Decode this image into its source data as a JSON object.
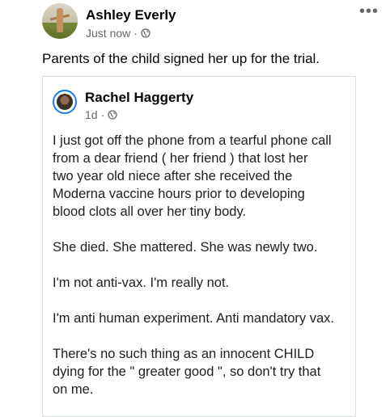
{
  "post": {
    "author": "Ashley Everly",
    "timestamp": "Just now",
    "separator": "·",
    "privacy_icon": "globe-icon",
    "more_label": "•••",
    "text": "Parents of the child signed her up for the trial."
  },
  "shared_post": {
    "author": "Rachel Haggerty",
    "timestamp": "1d",
    "separator": "·",
    "privacy_icon": "globe-icon",
    "paragraphs": [
      {
        "lines": [
          "I just got off the phone from a tearful phone call",
          "from a dear friend ( her friend ) that lost her",
          "two year old niece after she received the",
          "Moderna vaccine hours prior to developing",
          "blood clots all over her tiny body."
        ]
      },
      {
        "lines": [
          "She died. She mattered. She was newly two."
        ]
      },
      {
        "lines": [
          "I'm not anti-vax. I'm really not."
        ]
      },
      {
        "lines": [
          "I'm anti human experiment. Anti mandatory vax."
        ]
      },
      {
        "lines": [
          "There's no such thing as an innocent CHILD",
          "dying for the \" greater good \", so don't try that",
          "on me."
        ]
      }
    ]
  },
  "colors": {
    "text": "#050505",
    "meta": "#65676b",
    "border": "#dadde1",
    "accent": "#1877f2"
  }
}
